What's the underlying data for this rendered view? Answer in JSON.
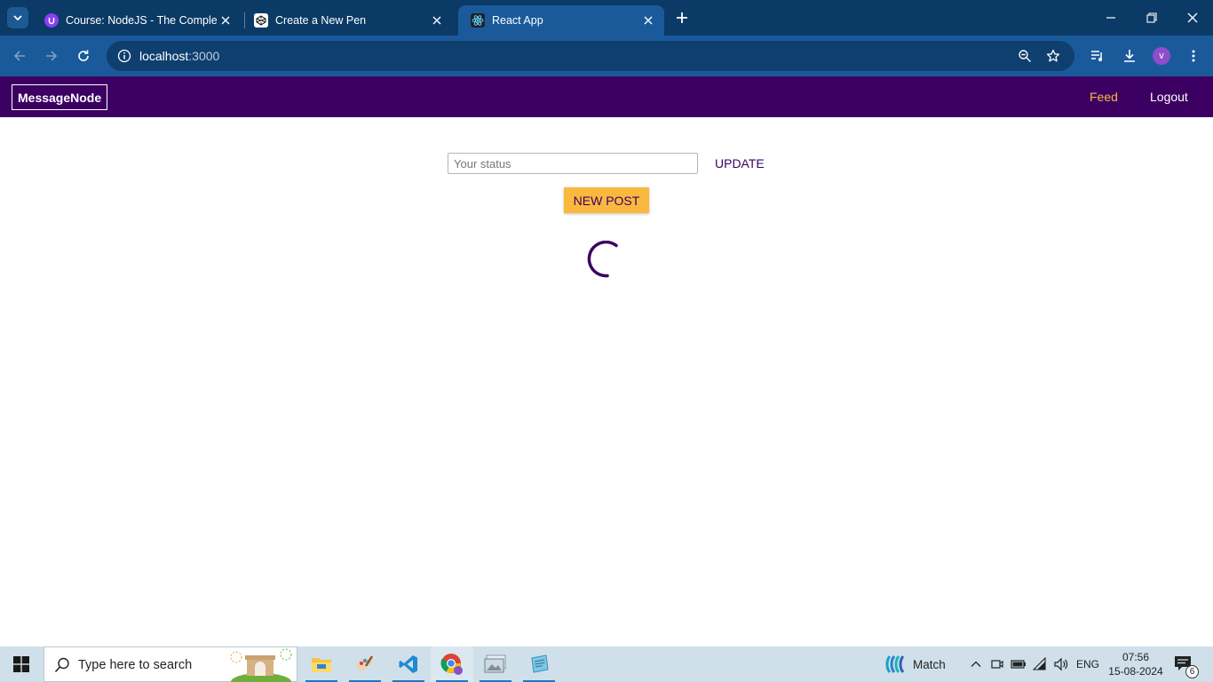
{
  "browser": {
    "tabs": [
      {
        "title": "Course: NodeJS - The Complete",
        "favicon": "udemy-icon"
      },
      {
        "title": "Create a New Pen",
        "favicon": "codepen-icon"
      },
      {
        "title": "React App",
        "favicon": "react-icon"
      }
    ],
    "active_tab": 2,
    "url_host": "localhost",
    "url_port": ":3000"
  },
  "app": {
    "logo": "MessageNode",
    "nav": {
      "feed": "Feed",
      "logout": "Logout"
    },
    "status": {
      "placeholder": "Your status",
      "value": "",
      "update_label": "UPDATE"
    },
    "new_post_label": "NEW POST",
    "loading": true
  },
  "taskbar": {
    "search_placeholder": "Type here to search",
    "apps": [
      "file-explorer-icon",
      "paint-icon",
      "vscode-icon",
      "chrome-icon",
      "photos-icon",
      "notepad-icon"
    ],
    "weather_text": "Match",
    "language": "ENG",
    "time": "07:56",
    "date": "15-08-2024",
    "notification_count": "6"
  },
  "colors": {
    "brand": "#3b0062",
    "accent": "#fab83f",
    "browser_frame": "#0b3a66",
    "browser_active": "#1a5a9b"
  }
}
